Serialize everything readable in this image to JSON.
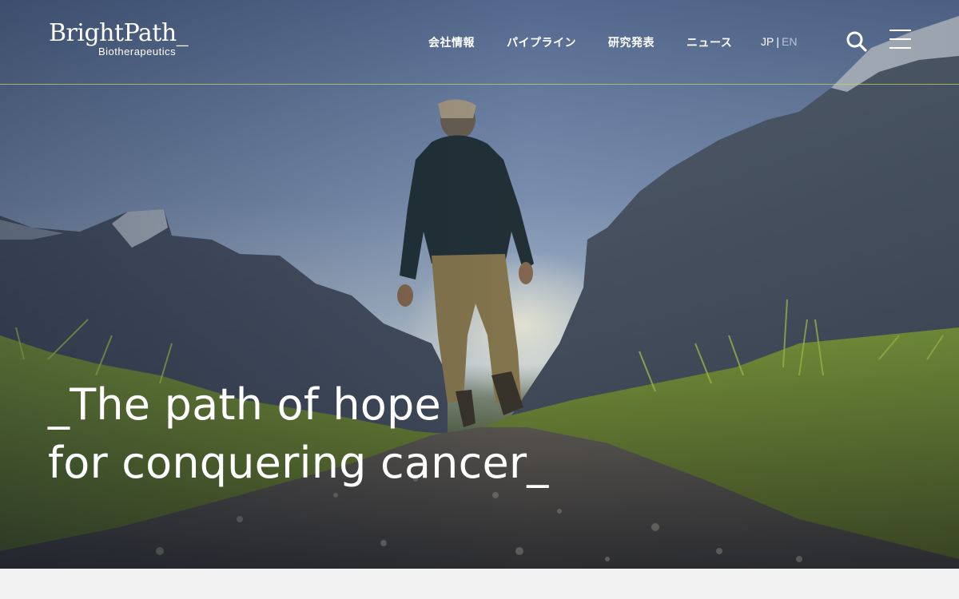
{
  "brand": {
    "name": "BrightPath_",
    "subtitle": "Biotherapeutics"
  },
  "nav": {
    "items": [
      {
        "label": "会社情報"
      },
      {
        "label": "パイプライン"
      },
      {
        "label": "研究発表"
      },
      {
        "label": "ニュース"
      }
    ]
  },
  "language": {
    "jp": "JP",
    "separator": "|",
    "en": "EN",
    "active": "JP"
  },
  "icons": {
    "search": "search-icon",
    "menu": "hamburger-menu-icon"
  },
  "hero": {
    "tagline_line1": "_The path of hope",
    "tagline_line2": "for conquering cancer_"
  },
  "colors": {
    "header_rule": "#bed26e",
    "text": "#ffffff",
    "lang_inactive": "#b8c3d4",
    "below_fold": "#f2f2f2"
  }
}
